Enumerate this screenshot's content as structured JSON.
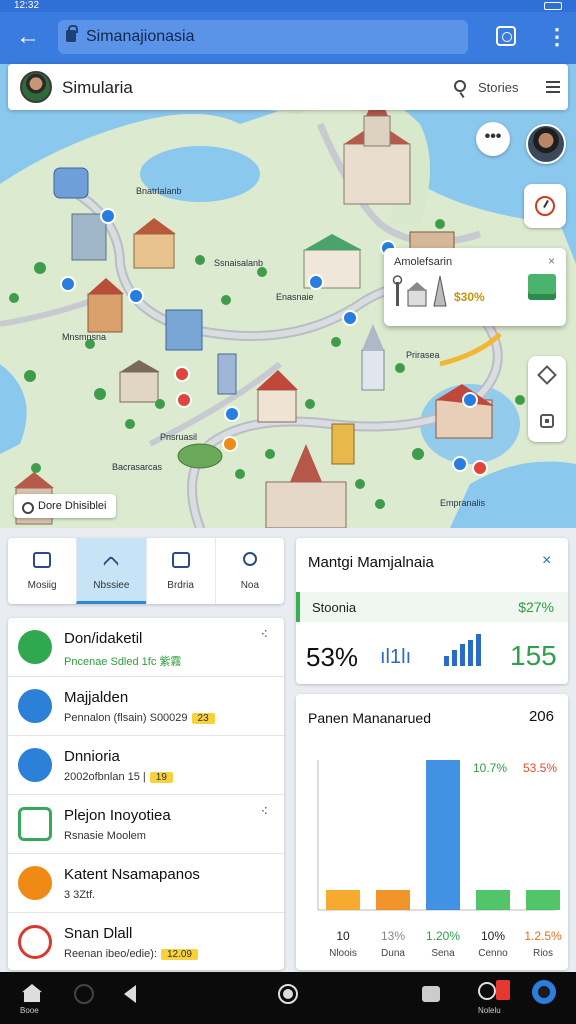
{
  "status": {
    "time": "12:32"
  },
  "browser": {
    "url": "Simanajionasia"
  },
  "app": {
    "title": "Simularia",
    "stories_label": "Stories"
  },
  "map": {
    "labels": [
      "Bnatrlalanb",
      "Ssnaisalanb",
      "Enasnaie",
      "Mnsmnsna",
      "Prirasea",
      "Pnsruasil",
      "Bacrasarcas",
      "Empranalis"
    ],
    "chip_label": "Dore Dhisiblei",
    "popup": {
      "title": "Amolefsarin",
      "value": "$30% ",
      "close": "×"
    }
  },
  "tabs": [
    {
      "label": "Mosiig",
      "icon": "people-icon"
    },
    {
      "label": "Nbssiee",
      "icon": "chevron-up-icon"
    },
    {
      "label": "Brdria",
      "icon": "home-icon"
    },
    {
      "label": "Noa",
      "icon": "person-icon"
    }
  ],
  "list": [
    {
      "title": "Don/idaketil",
      "subtitle": "Pncenae Sdled 1fc 紫霧",
      "badge": "",
      "action": "⠪",
      "color": "#2fa84f",
      "icon": "refresh-icon"
    },
    {
      "title": "Majjalden",
      "subtitle": "Pennalon (flsain) S00029",
      "badge": "23",
      "action": "",
      "color": "#2c80d8",
      "icon": "gear-icon"
    },
    {
      "title": "Dnnioria",
      "subtitle": "2002ofbnlan 15 |",
      "badge": "19",
      "action": "",
      "color": "#2c80d8",
      "icon": "square-icon"
    },
    {
      "title": "Plejon Inoyotiea",
      "subtitle": "Rsnasie Moolem",
      "badge": "",
      "action": "⠪",
      "color": "#38a85a",
      "icon": "shield-icon"
    },
    {
      "title": "Katent Nsamapanos",
      "subtitle": "3 3Ztf.",
      "badge": "",
      "action": "",
      "color": "#f08a14",
      "icon": "swirl-icon"
    },
    {
      "title": "Snan Dlall",
      "subtitle": "Reenan ibeo/edie):",
      "badge": "12.09",
      "action": "",
      "color": "#d93a2b",
      "icon": "tooth-icon"
    }
  ],
  "metric": {
    "title": "Mantgi Mamjalnaia",
    "close": "×",
    "band_label": "Stoonia",
    "band_value": "$27%",
    "value1": "53%",
    "value2": "ıl1lı",
    "value3": "155"
  },
  "chart_card": {
    "title": "Panen Mananarued",
    "value": "206"
  },
  "chart_data": {
    "type": "bar",
    "categories": [
      "Nloois",
      "Duna",
      "Sena",
      "Cenno",
      "Rios"
    ],
    "values": [
      10,
      15,
      120,
      10,
      12.5
    ],
    "value_labels": [
      "10",
      "13%",
      "1.20%",
      "10%",
      "1.2.5%"
    ],
    "top_labels": [
      "10.7%",
      "53.5%"
    ],
    "series_colors": [
      "#f5a11a",
      "#f08a14",
      "#2d86e0",
      "#3fbe5a",
      "#3fbe5a"
    ],
    "label_colors": [
      "#222",
      "#888",
      "#2ea04a",
      "#222",
      "#e86f1a"
    ],
    "top_label_colors": [
      "#2ea04a",
      "#e05030"
    ]
  },
  "sysnav": {
    "home_label": "Booe",
    "right_label": "Nolelu"
  }
}
